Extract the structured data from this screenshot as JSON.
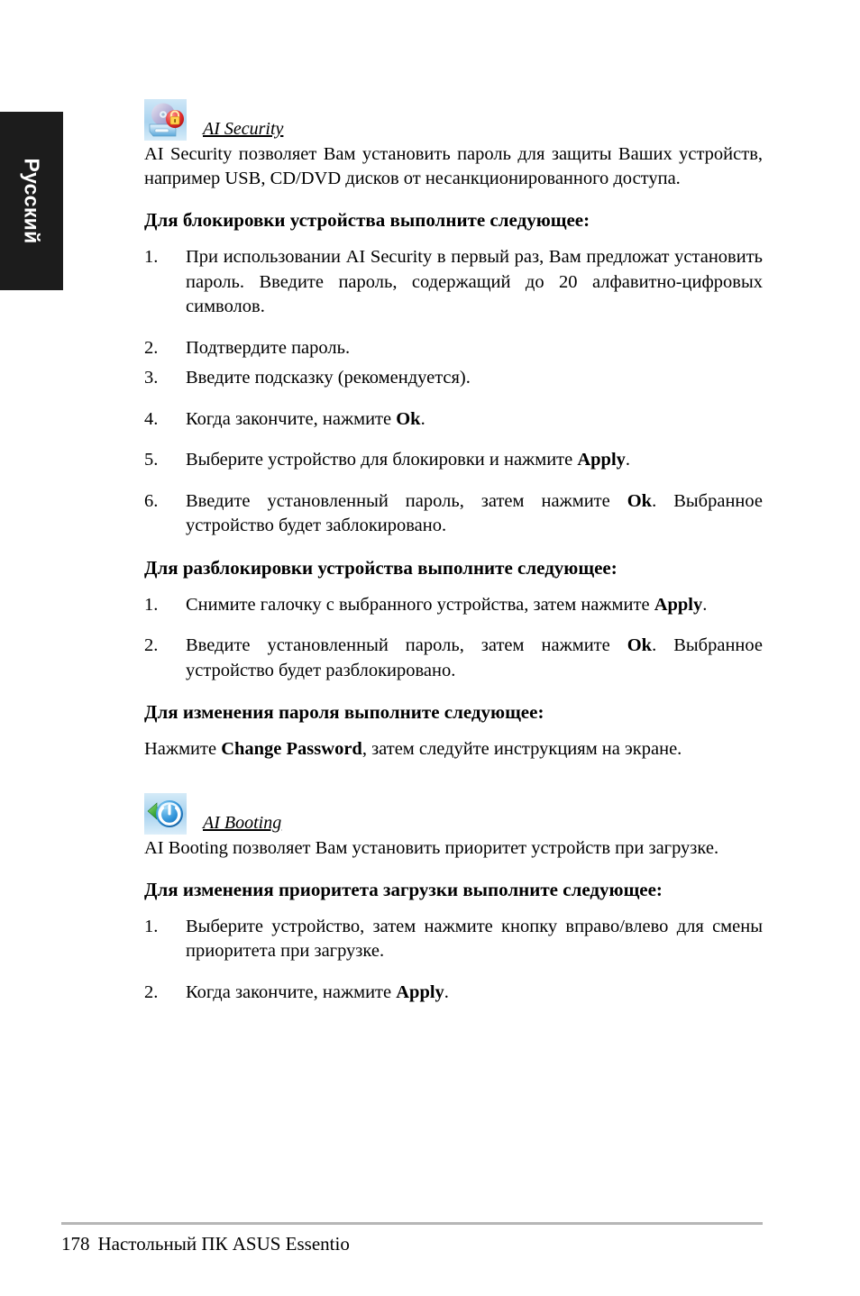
{
  "sidebar": {
    "language_tab": "Русский"
  },
  "sections": [
    {
      "icon_name": "ai-security-icon",
      "feature_name": "AI Security",
      "intro": "AI Security позволяет Вам установить пароль для защиты Ваших устройств, например USB, CD/DVD дисков от несанкционированного доступа."
    },
    {
      "icon_name": "ai-booting-icon",
      "feature_name": "AI Booting",
      "intro": "AI Booting позволяет Вам установить приоритет устройств при загрузке."
    }
  ],
  "headings": {
    "lock_device": "Для блокировки устройства выполните следующее:",
    "unlock_device": "Для разблокировки устройства выполните следующее:",
    "change_password": "Для изменения пароля выполните следующее:",
    "change_boot_priority": "Для изменения приоритета загрузки выполните следующее:"
  },
  "lock_steps": [
    {
      "num": "1.",
      "pre": "При использовании AI Security в первый раз, Вам предложат установить пароль. Введите пароль, содержащий до 20 алфавитно-цифровых символов.",
      "bold": "",
      "post": ""
    },
    {
      "num": "2.",
      "pre": "Подтвердите пароль.",
      "bold": "",
      "post": ""
    },
    {
      "num": "3.",
      "pre": "Введите подсказку (рекомендуется).",
      "bold": "",
      "post": ""
    },
    {
      "num": "4.",
      "pre": "Когда закончите, нажмите ",
      "bold": "Ok",
      "post": "."
    },
    {
      "num": "5.",
      "pre": "Выберите устройство для блокировки и нажмите ",
      "bold": "Apply",
      "post": "."
    },
    {
      "num": "6.",
      "pre": "Введите установленный пароль, затем нажмите ",
      "bold": "Ok",
      "post": ". Выбранное устройство будет заблокировано."
    }
  ],
  "unlock_steps": [
    {
      "num": "1.",
      "pre": "Снимите галочку с выбранного устройства, затем нажмите ",
      "bold": "Apply",
      "post": "."
    },
    {
      "num": "2.",
      "pre": "Введите установленный пароль, затем нажмите ",
      "bold": "Ok",
      "post": ". Выбранное устройство будет разблокировано."
    }
  ],
  "change_password_body": {
    "pre": "Нажмите ",
    "bold": "Change Password",
    "post": ", затем следуйте инструкциям на экране."
  },
  "boot_steps": [
    {
      "num": "1.",
      "pre": "Выберите устройство, затем нажмите кнопку вправо/влево для смены приоритета при загрузке.",
      "bold": "",
      "post": ""
    },
    {
      "num": "2.",
      "pre": "Когда закончите, нажмите ",
      "bold": "Apply",
      "post": "."
    }
  ],
  "footer": {
    "page_number": "178",
    "product": "Настольный ПК ASUS Essentio"
  },
  "colors": {
    "tab_background": "#1c1c1c",
    "tab_text": "#ffffff",
    "footer_rule": "#b6b6b6",
    "text": "#000000"
  }
}
